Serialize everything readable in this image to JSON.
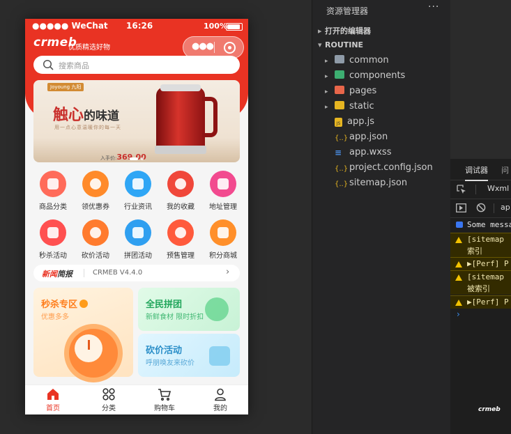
{
  "phone": {
    "status": {
      "carrier": "●●●●● WeChat",
      "time": "16:26",
      "battery": "100%"
    },
    "logo": "crmeb",
    "slogan": "优质精选好物",
    "search_placeholder": "搜索商品",
    "banner": {
      "brand": "Joyoung 九阳",
      "headline_a": "触",
      "headline_b": "心",
      "headline_c": "的味道",
      "subline": "用一点心意温暖你的每一天",
      "price_label": "入手价:",
      "price": "369.00"
    },
    "icons_row1": [
      {
        "label": "商品分类",
        "color": "#ff6b5a",
        "icon": "category-icon"
      },
      {
        "label": "领优惠券",
        "color": "#ff8a2a",
        "icon": "coupon-icon"
      },
      {
        "label": "行业资讯",
        "color": "#2fa6f5",
        "icon": "news-icon"
      },
      {
        "label": "我的收藏",
        "color": "#f0473a",
        "icon": "favorite-icon"
      },
      {
        "label": "地址管理",
        "color": "#f24a8f",
        "icon": "address-icon"
      }
    ],
    "icons_row2": [
      {
        "label": "秒杀活动",
        "color": "#ff5050",
        "icon": "seckill-icon"
      },
      {
        "label": "砍价活动",
        "color": "#ff7b2e",
        "icon": "bargain-icon"
      },
      {
        "label": "拼团活动",
        "color": "#2f9ff0",
        "icon": "group-buy-icon"
      },
      {
        "label": "预售管理",
        "color": "#ff5a3c",
        "icon": "presale-icon"
      },
      {
        "label": "积分商城",
        "color": "#ff8f2a",
        "icon": "points-mall-icon"
      }
    ],
    "news": {
      "title_a": "新闻",
      "title_b": "简报",
      "text": "CRMEB V4.4.0"
    },
    "cards": {
      "seckill": {
        "title": "秒杀专区",
        "sub": "优惠多多",
        "color": "#ff7e1c"
      },
      "group": {
        "title": "全民拼团",
        "sub": "新鲜食材 限时折扣",
        "color": "#1fa55a"
      },
      "bargain": {
        "title": "砍价活动",
        "sub": "呼朋唤友来砍价",
        "color": "#2a8ec8"
      }
    },
    "tabbar": [
      {
        "label": "首页",
        "active": true
      },
      {
        "label": "分类",
        "active": false
      },
      {
        "label": "购物车",
        "active": false
      },
      {
        "label": "我的",
        "active": false
      }
    ],
    "accent": "#e93323"
  },
  "explorer": {
    "title": "资源管理器",
    "more": "···",
    "open_editors": "打开的编辑器",
    "root": "ROUTINE",
    "items": [
      {
        "name": "common",
        "type": "folder",
        "color": "#8f9ba8"
      },
      {
        "name": "components",
        "type": "folder",
        "color": "#3dae71"
      },
      {
        "name": "pages",
        "type": "folder",
        "color": "#e8664a"
      },
      {
        "name": "static",
        "type": "folder",
        "color": "#e6b521"
      },
      {
        "name": "app.js",
        "type": "js"
      },
      {
        "name": "app.json",
        "type": "json"
      },
      {
        "name": "app.wxss",
        "type": "wxss"
      },
      {
        "name": "project.config.json",
        "type": "json"
      },
      {
        "name": "sitemap.json",
        "type": "json"
      }
    ]
  },
  "debugger": {
    "tab1": "调试器",
    "tab2": "问",
    "panel": "Wxml",
    "filter": "ap",
    "console": [
      {
        "kind": "info",
        "text": "Some messa"
      },
      {
        "kind": "warn",
        "text": "[sitemap",
        "text2": "索引"
      },
      {
        "kind": "warn",
        "text": "▶[Perf] P"
      },
      {
        "kind": "warn",
        "text": "[sitemap",
        "text2": "被索引"
      },
      {
        "kind": "warn",
        "text": "▶[Perf] P"
      }
    ],
    "prompt": "›"
  },
  "corner_logo": "crmeb"
}
